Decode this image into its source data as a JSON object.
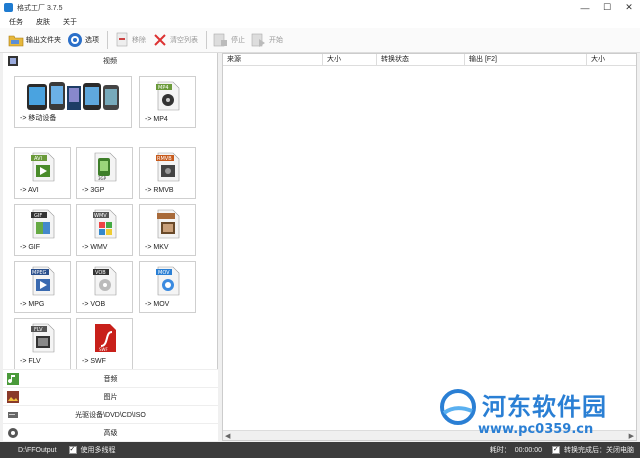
{
  "window": {
    "title": "格式工厂 3.7.5",
    "min": "—",
    "max": "☐",
    "close": "✕"
  },
  "menu": [
    "任务",
    "皮肤",
    "关于"
  ],
  "toolbar": {
    "output_folder": "输出文件夹",
    "options": "选项",
    "remove": "移除",
    "clear_list": "清空列表",
    "stop": "停止",
    "start": "开始"
  },
  "left": {
    "video_header": "视频",
    "formats": [
      {
        "label": "-> 移动设备",
        "icon": "mobile-devices-icon",
        "badge": ""
      },
      {
        "label": "-> MP4",
        "icon": "mp4-icon",
        "badge": "MP4"
      },
      {
        "label": "-> AVI",
        "icon": "avi-icon",
        "badge": "AVI"
      },
      {
        "label": "-> 3GP",
        "icon": "3gp-icon",
        "badge": "3GP"
      },
      {
        "label": "-> RMVB",
        "icon": "rmvb-icon",
        "badge": "RMVB"
      },
      {
        "label": "-> GIF",
        "icon": "gif-icon",
        "badge": "GIF"
      },
      {
        "label": "-> WMV",
        "icon": "wmv-icon",
        "badge": "WMV"
      },
      {
        "label": "-> MKV",
        "icon": "mkv-icon",
        "badge": ""
      },
      {
        "label": "-> MPG",
        "icon": "mpg-icon",
        "badge": "MPEG"
      },
      {
        "label": "-> VOB",
        "icon": "vob-icon",
        "badge": "VOB"
      },
      {
        "label": "-> MOV",
        "icon": "mov-icon",
        "badge": "MOV"
      },
      {
        "label": "-> FLV",
        "icon": "flv-icon",
        "badge": "FLV"
      },
      {
        "label": "-> SWF",
        "icon": "swf-icon",
        "badge": "SWF"
      }
    ],
    "categories": [
      "音频",
      "图片",
      "光驱设备\\DVD\\CD\\ISO",
      "高级"
    ]
  },
  "table": {
    "columns": [
      "来源",
      "大小",
      "转换状态",
      "输出 [F2]",
      "大小"
    ]
  },
  "status": {
    "output_path": "D:\\FFOutput",
    "multithread": "使用多线程",
    "elapsed_label": "耗时：",
    "elapsed_value": "00:00:00",
    "after_done": "转换完成后：关闭电脑"
  },
  "watermark": {
    "title": "河东软件园",
    "url": "www.pc0359.cn"
  },
  "colors": {
    "accent": "#2a7fd4",
    "statusbar": "#3c3c3c"
  }
}
